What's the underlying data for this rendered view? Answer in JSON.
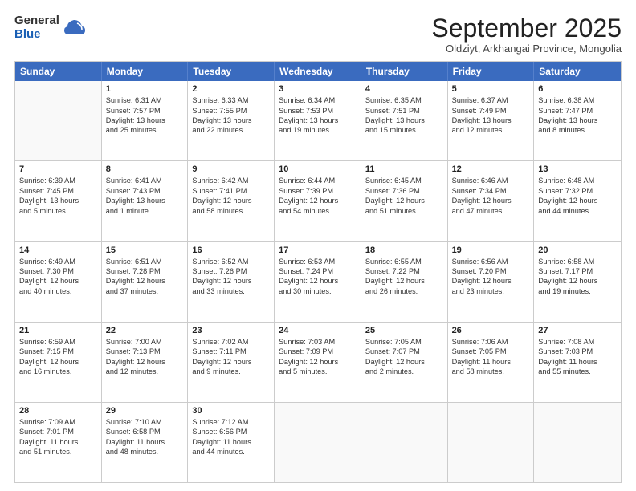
{
  "logo": {
    "general": "General",
    "blue": "Blue"
  },
  "header": {
    "month": "September 2025",
    "location": "Oldziyt, Arkhangai Province, Mongolia"
  },
  "weekdays": [
    "Sunday",
    "Monday",
    "Tuesday",
    "Wednesday",
    "Thursday",
    "Friday",
    "Saturday"
  ],
  "rows": [
    [
      {
        "day": "",
        "lines": []
      },
      {
        "day": "1",
        "lines": [
          "Sunrise: 6:31 AM",
          "Sunset: 7:57 PM",
          "Daylight: 13 hours",
          "and 25 minutes."
        ]
      },
      {
        "day": "2",
        "lines": [
          "Sunrise: 6:33 AM",
          "Sunset: 7:55 PM",
          "Daylight: 13 hours",
          "and 22 minutes."
        ]
      },
      {
        "day": "3",
        "lines": [
          "Sunrise: 6:34 AM",
          "Sunset: 7:53 PM",
          "Daylight: 13 hours",
          "and 19 minutes."
        ]
      },
      {
        "day": "4",
        "lines": [
          "Sunrise: 6:35 AM",
          "Sunset: 7:51 PM",
          "Daylight: 13 hours",
          "and 15 minutes."
        ]
      },
      {
        "day": "5",
        "lines": [
          "Sunrise: 6:37 AM",
          "Sunset: 7:49 PM",
          "Daylight: 13 hours",
          "and 12 minutes."
        ]
      },
      {
        "day": "6",
        "lines": [
          "Sunrise: 6:38 AM",
          "Sunset: 7:47 PM",
          "Daylight: 13 hours",
          "and 8 minutes."
        ]
      }
    ],
    [
      {
        "day": "7",
        "lines": [
          "Sunrise: 6:39 AM",
          "Sunset: 7:45 PM",
          "Daylight: 13 hours",
          "and 5 minutes."
        ]
      },
      {
        "day": "8",
        "lines": [
          "Sunrise: 6:41 AM",
          "Sunset: 7:43 PM",
          "Daylight: 13 hours",
          "and 1 minute."
        ]
      },
      {
        "day": "9",
        "lines": [
          "Sunrise: 6:42 AM",
          "Sunset: 7:41 PM",
          "Daylight: 12 hours",
          "and 58 minutes."
        ]
      },
      {
        "day": "10",
        "lines": [
          "Sunrise: 6:44 AM",
          "Sunset: 7:39 PM",
          "Daylight: 12 hours",
          "and 54 minutes."
        ]
      },
      {
        "day": "11",
        "lines": [
          "Sunrise: 6:45 AM",
          "Sunset: 7:36 PM",
          "Daylight: 12 hours",
          "and 51 minutes."
        ]
      },
      {
        "day": "12",
        "lines": [
          "Sunrise: 6:46 AM",
          "Sunset: 7:34 PM",
          "Daylight: 12 hours",
          "and 47 minutes."
        ]
      },
      {
        "day": "13",
        "lines": [
          "Sunrise: 6:48 AM",
          "Sunset: 7:32 PM",
          "Daylight: 12 hours",
          "and 44 minutes."
        ]
      }
    ],
    [
      {
        "day": "14",
        "lines": [
          "Sunrise: 6:49 AM",
          "Sunset: 7:30 PM",
          "Daylight: 12 hours",
          "and 40 minutes."
        ]
      },
      {
        "day": "15",
        "lines": [
          "Sunrise: 6:51 AM",
          "Sunset: 7:28 PM",
          "Daylight: 12 hours",
          "and 37 minutes."
        ]
      },
      {
        "day": "16",
        "lines": [
          "Sunrise: 6:52 AM",
          "Sunset: 7:26 PM",
          "Daylight: 12 hours",
          "and 33 minutes."
        ]
      },
      {
        "day": "17",
        "lines": [
          "Sunrise: 6:53 AM",
          "Sunset: 7:24 PM",
          "Daylight: 12 hours",
          "and 30 minutes."
        ]
      },
      {
        "day": "18",
        "lines": [
          "Sunrise: 6:55 AM",
          "Sunset: 7:22 PM",
          "Daylight: 12 hours",
          "and 26 minutes."
        ]
      },
      {
        "day": "19",
        "lines": [
          "Sunrise: 6:56 AM",
          "Sunset: 7:20 PM",
          "Daylight: 12 hours",
          "and 23 minutes."
        ]
      },
      {
        "day": "20",
        "lines": [
          "Sunrise: 6:58 AM",
          "Sunset: 7:17 PM",
          "Daylight: 12 hours",
          "and 19 minutes."
        ]
      }
    ],
    [
      {
        "day": "21",
        "lines": [
          "Sunrise: 6:59 AM",
          "Sunset: 7:15 PM",
          "Daylight: 12 hours",
          "and 16 minutes."
        ]
      },
      {
        "day": "22",
        "lines": [
          "Sunrise: 7:00 AM",
          "Sunset: 7:13 PM",
          "Daylight: 12 hours",
          "and 12 minutes."
        ]
      },
      {
        "day": "23",
        "lines": [
          "Sunrise: 7:02 AM",
          "Sunset: 7:11 PM",
          "Daylight: 12 hours",
          "and 9 minutes."
        ]
      },
      {
        "day": "24",
        "lines": [
          "Sunrise: 7:03 AM",
          "Sunset: 7:09 PM",
          "Daylight: 12 hours",
          "and 5 minutes."
        ]
      },
      {
        "day": "25",
        "lines": [
          "Sunrise: 7:05 AM",
          "Sunset: 7:07 PM",
          "Daylight: 12 hours",
          "and 2 minutes."
        ]
      },
      {
        "day": "26",
        "lines": [
          "Sunrise: 7:06 AM",
          "Sunset: 7:05 PM",
          "Daylight: 11 hours",
          "and 58 minutes."
        ]
      },
      {
        "day": "27",
        "lines": [
          "Sunrise: 7:08 AM",
          "Sunset: 7:03 PM",
          "Daylight: 11 hours",
          "and 55 minutes."
        ]
      }
    ],
    [
      {
        "day": "28",
        "lines": [
          "Sunrise: 7:09 AM",
          "Sunset: 7:01 PM",
          "Daylight: 11 hours",
          "and 51 minutes."
        ]
      },
      {
        "day": "29",
        "lines": [
          "Sunrise: 7:10 AM",
          "Sunset: 6:58 PM",
          "Daylight: 11 hours",
          "and 48 minutes."
        ]
      },
      {
        "day": "30",
        "lines": [
          "Sunrise: 7:12 AM",
          "Sunset: 6:56 PM",
          "Daylight: 11 hours",
          "and 44 minutes."
        ]
      },
      {
        "day": "",
        "lines": []
      },
      {
        "day": "",
        "lines": []
      },
      {
        "day": "",
        "lines": []
      },
      {
        "day": "",
        "lines": []
      }
    ]
  ]
}
